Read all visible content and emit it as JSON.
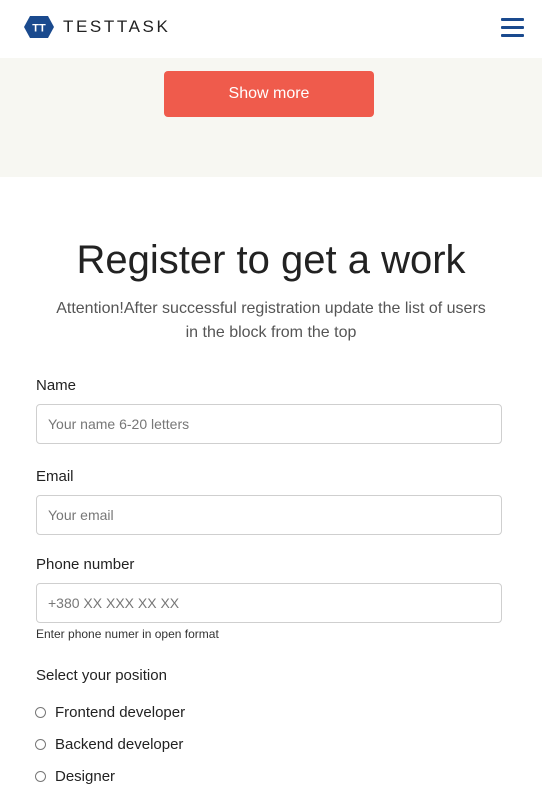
{
  "header": {
    "brand": "TESTTASK",
    "logo_mark": "TT",
    "menu_icon": "hamburger-menu-icon",
    "brand_color": "#1a4a8e"
  },
  "users_block": {
    "show_more_label": "Show more",
    "button_color": "#ef5b4c",
    "band_color": "#f7f7f2"
  },
  "register": {
    "title": "Register to get a work",
    "subtitle_line1": "Attention!After successful registration update the list of users",
    "subtitle_line2": "in the block from the top",
    "name_label": "Name",
    "name_placeholder": "Your name 6-20 letters",
    "email_label": "Email",
    "email_placeholder": "Your email",
    "phone_label": "Phone number",
    "phone_placeholder": "+380 XX XXX XX XX",
    "phone_hint": "Enter phone numer in open format",
    "position_label": "Select your position",
    "positions": [
      {
        "label": "Frontend developer",
        "checked": false
      },
      {
        "label": "Backend developer",
        "checked": false
      },
      {
        "label": "Designer",
        "checked": false
      }
    ]
  }
}
